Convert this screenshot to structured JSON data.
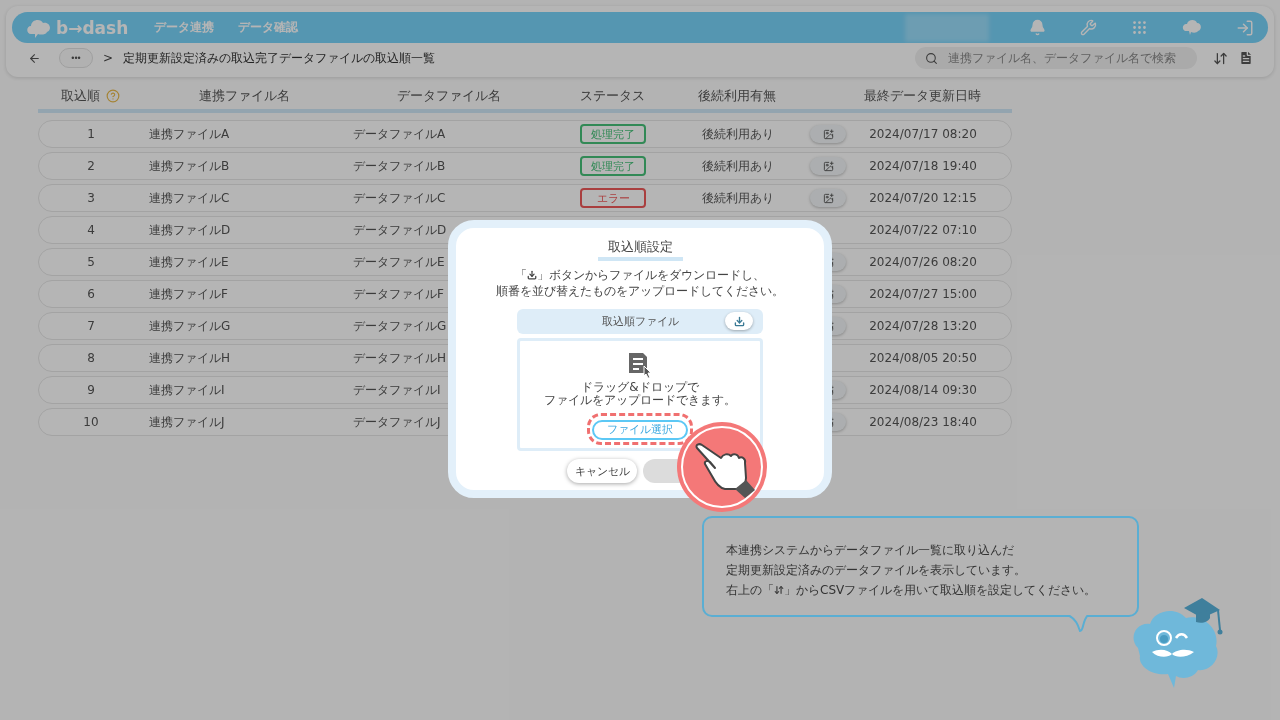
{
  "nav": {
    "logo_text": "b→dash",
    "menu": [
      {
        "label": "データ連携"
      },
      {
        "label": "データ確認"
      }
    ]
  },
  "toolbar": {
    "breadcrumb_more": "•••",
    "separator": ">",
    "page_title": "定期更新設定済みの取込完了データファイルの取込順一覧",
    "search": {
      "placeholder": "連携ファイル名、データファイル名で検索"
    }
  },
  "table": {
    "columns": [
      "取込順",
      "連携ファイル名",
      "データファイル名",
      "ステータス",
      "後続利用有無",
      "最終データ更新日時"
    ],
    "rows": [
      {
        "order": "1",
        "link_file": "連携ファイルA",
        "data_file": "データファイルA",
        "status": {
          "label": "処理完了",
          "kind": "done"
        },
        "usage": "後続利用あり",
        "has_detail": true,
        "updated": "2024/07/17 08:20"
      },
      {
        "order": "2",
        "link_file": "連携ファイルB",
        "data_file": "データファイルB",
        "status": {
          "label": "処理完了",
          "kind": "done"
        },
        "usage": "後続利用あり",
        "has_detail": true,
        "updated": "2024/07/18 19:40"
      },
      {
        "order": "3",
        "link_file": "連携ファイルC",
        "data_file": "データファイルC",
        "status": {
          "label": "エラー",
          "kind": "error"
        },
        "usage": "後続利用あり",
        "has_detail": true,
        "updated": "2024/07/20 12:15"
      },
      {
        "order": "4",
        "link_file": "連携ファイルD",
        "data_file": "データファイルD",
        "has_detail": false,
        "updated": "2024/07/22 07:10"
      },
      {
        "order": "5",
        "link_file": "連携ファイルE",
        "data_file": "データファイルE",
        "has_detail": true,
        "updated": "2024/07/26 08:20"
      },
      {
        "order": "6",
        "link_file": "連携ファイルF",
        "data_file": "データファイルF",
        "has_detail": true,
        "updated": "2024/07/27 15:00"
      },
      {
        "order": "7",
        "link_file": "連携ファイルG",
        "data_file": "データファイルG",
        "has_detail": true,
        "updated": "2024/07/28 13:20"
      },
      {
        "order": "8",
        "link_file": "連携ファイルH",
        "data_file": "データファイルH",
        "has_detail": false,
        "updated": "2024/08/05 20:50"
      },
      {
        "order": "9",
        "link_file": "連携ファイルI",
        "data_file": "データファイルI",
        "has_detail": true,
        "updated": "2024/08/14 09:30"
      },
      {
        "order": "10",
        "link_file": "連携ファイルJ",
        "data_file": "データファイルJ",
        "has_detail": true,
        "updated": "2024/08/23 18:40"
      }
    ]
  },
  "dialog": {
    "title": "取込順設定",
    "instruction": {
      "before_icon": "「",
      "after_icon": "」ボタンからファイルをダウンロードし、",
      "line_2": "順番を並び替えたものをアップロードしてください。"
    },
    "file_panel_title": "取込順ファイル",
    "drop_text": [
      "ドラッグ&ドロップで",
      "ファイルをアップロードできます。"
    ],
    "select_button": "ファイル選択",
    "select_highlighted": true,
    "cancel_button": "キャンセル",
    "confirm_disabled": true
  },
  "guide": {
    "lines": [
      "本連携システムからデータファイル一覧に取り込んだ",
      "定期更新設定済みのデータファイルを表示しています。"
    ],
    "line_3": {
      "before_icon": "右上の「",
      "after_icon": "」からCSVファイルを用いて取込順を設定してください。"
    }
  }
}
